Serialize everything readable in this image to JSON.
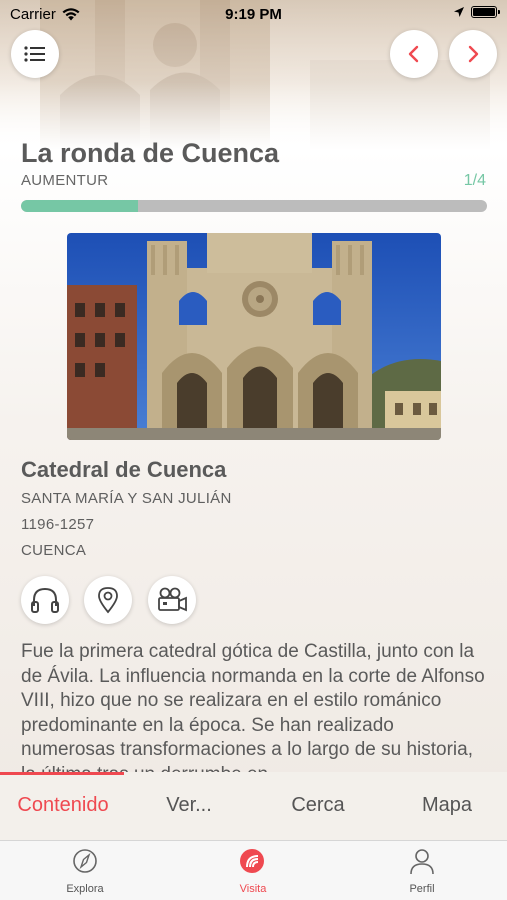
{
  "status_bar": {
    "carrier": "Carrier",
    "time": "9:19 PM",
    "battery_percent": 100
  },
  "header": {
    "route_title": "La ronda de Cuenca",
    "route_subtitle": "AUMENTUR",
    "step_counter": "1/4",
    "progress_fraction": 0.25,
    "accent_color": "#76c7a5"
  },
  "place": {
    "title": "Catedral de Cuenca",
    "dedication": "SANTA MARÍA Y SAN JULIÁN",
    "years": "1196-1257",
    "city": "CUENCA",
    "description": "Fue la primera catedral gótica de Castilla, junto con la de Ávila. La influencia normanda en la corte de Alfonso VIII, hizo que no se realizara en el estilo románico predominante en la época. Se han realizado numerosas transformaciones a lo largo de su historia, la última tras un derrumbe en"
  },
  "media_buttons": [
    {
      "icon": "headphones-icon"
    },
    {
      "icon": "location-pin-icon"
    },
    {
      "icon": "video-camera-icon"
    }
  ],
  "content_tabs": [
    {
      "label": "Contenido",
      "active": true
    },
    {
      "label": "Ver...",
      "active": false
    },
    {
      "label": "Cerca",
      "active": false
    },
    {
      "label": "Mapa",
      "active": false
    }
  ],
  "bottom_nav": [
    {
      "label": "Explora",
      "icon": "compass-icon",
      "active": false
    },
    {
      "label": "Visita",
      "icon": "visit-signal-icon",
      "active": true
    },
    {
      "label": "Perfil",
      "icon": "profile-icon",
      "active": false
    }
  ],
  "colors": {
    "brand_red": "#ef4950",
    "progress_green": "#76c7a5",
    "progress_track": "#bcbcbc"
  }
}
